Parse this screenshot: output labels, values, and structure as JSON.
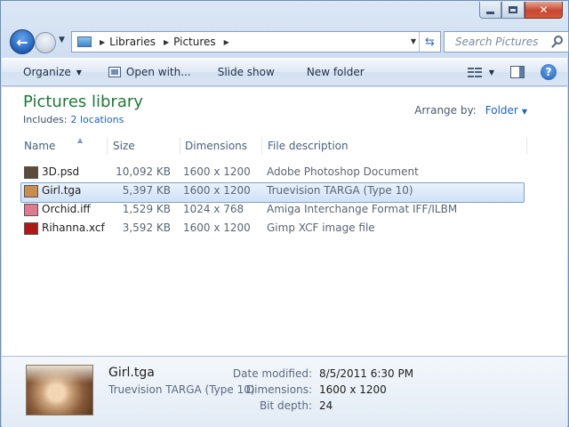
{
  "address": {
    "crumbs": [
      "Libraries",
      "Pictures"
    ]
  },
  "search": {
    "placeholder": "Search Pictures"
  },
  "toolbar": {
    "organize": "Organize",
    "open_with": "Open with...",
    "slide_show": "Slide show",
    "new_folder": "New folder"
  },
  "library": {
    "title": "Pictures library",
    "includes_label": "Includes:",
    "locations_link": "2 locations",
    "arrange_label": "Arrange by:",
    "arrange_value": "Folder"
  },
  "columns": [
    "Name",
    "Size",
    "Dimensions",
    "File description"
  ],
  "files": [
    {
      "name": "3D.psd",
      "size": "10,092 KB",
      "dimensions": "1600 x 1200",
      "description": "Adobe Photoshop Document",
      "thumb_color": "#5c4a3a",
      "selected": false
    },
    {
      "name": "Girl.tga",
      "size": "5,397 KB",
      "dimensions": "1600 x 1200",
      "description": "Truevision TARGA (Type 10)",
      "thumb_color": "#c98c4c",
      "selected": true
    },
    {
      "name": "Orchid.iff",
      "size": "1,529 KB",
      "dimensions": "1024 x 768",
      "description": "Amiga Interchange Format IFF/ILBM",
      "thumb_color": "#e07a8e",
      "selected": false
    },
    {
      "name": "Rihanna.xcf",
      "size": "3,592 KB",
      "dimensions": "1600 x 1200",
      "description": "Gimp XCF image file",
      "thumb_color": "#b01818",
      "selected": false
    }
  ],
  "details": {
    "name": "Girl.tga",
    "type": "Truevision TARGA (Type 10)",
    "date_modified_label": "Date modified:",
    "date_modified": "8/5/2011 6:30 PM",
    "dimensions_label": "Dimensions:",
    "dimensions": "1600 x 1200",
    "bit_depth_label": "Bit depth:",
    "bit_depth": "24"
  }
}
